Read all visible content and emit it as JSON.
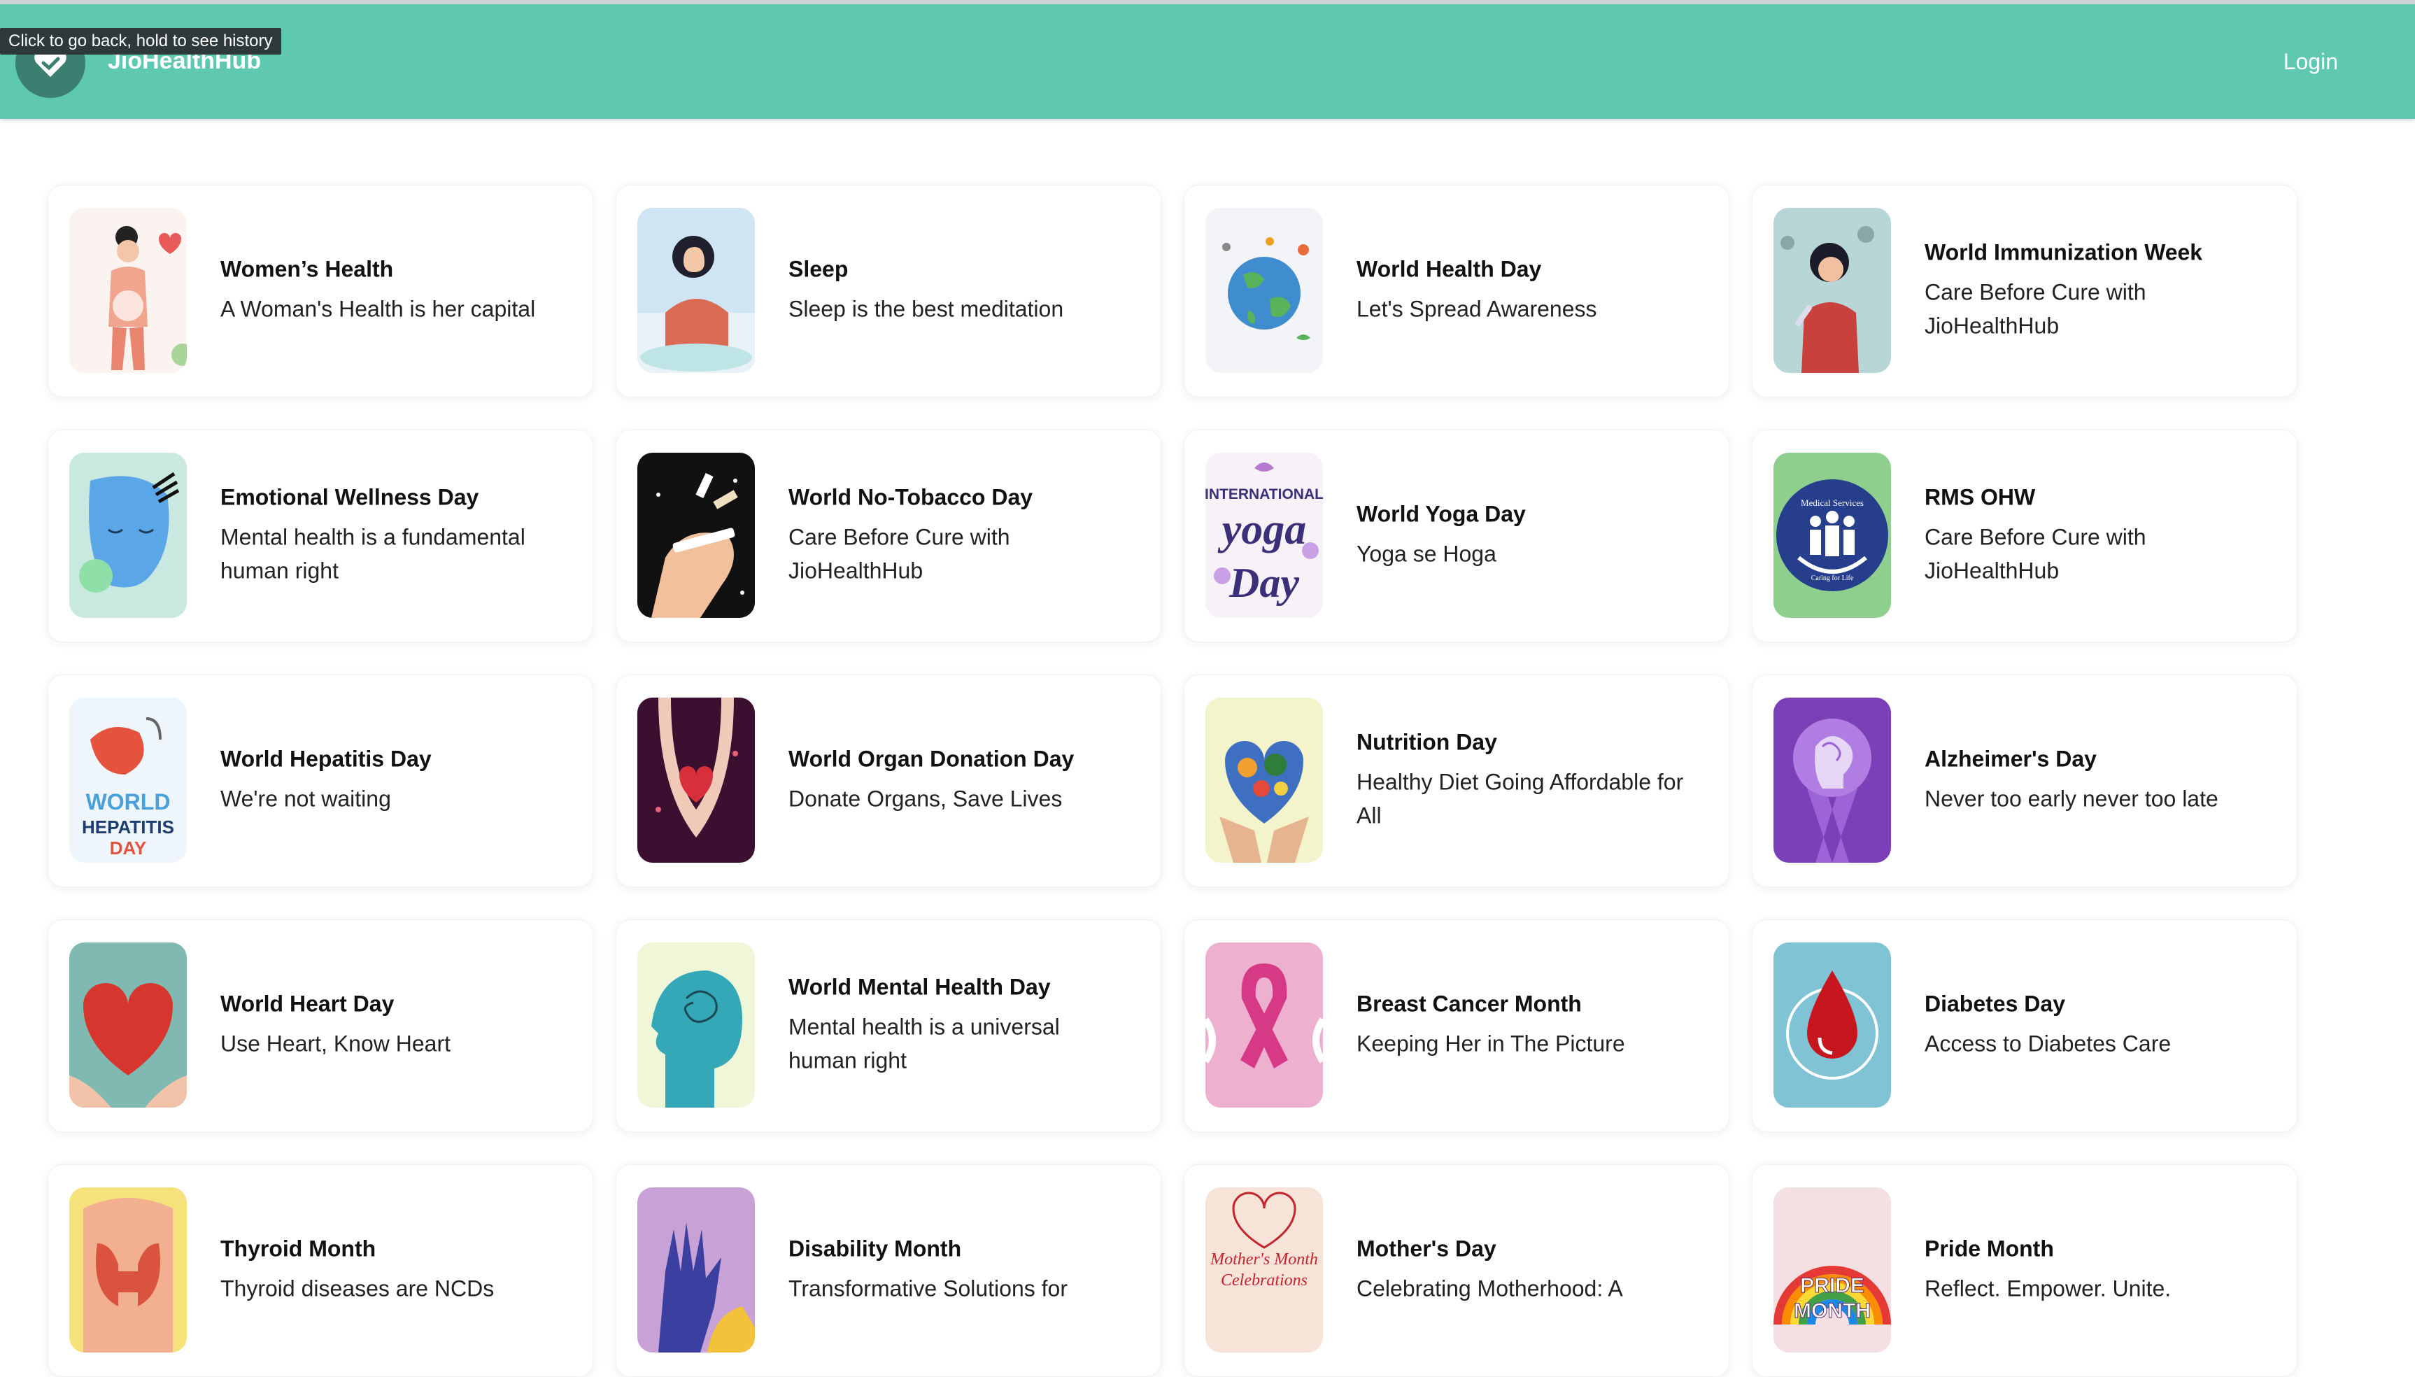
{
  "tooltip": "Click to go back, hold to see history",
  "header": {
    "brand": "JioHealthHub",
    "login": "Login",
    "accent": "#5ec8b1"
  },
  "cards": [
    {
      "title": "Women’s Health",
      "subtitle": "A Woman's Health is her capital",
      "image": "womens-health"
    },
    {
      "title": "Sleep",
      "subtitle": "Sleep is the best meditation",
      "image": "sleep"
    },
    {
      "title": "World Health Day",
      "subtitle": "Let's Spread Awareness",
      "image": "globe"
    },
    {
      "title": "World Immunization Week",
      "subtitle": "Care Before Cure with JioHealthHub",
      "image": "immunization"
    },
    {
      "title": "Emotional Wellness Day",
      "subtitle": "Mental health is a fundamental human right",
      "image": "emotional-face"
    },
    {
      "title": "World No-Tobacco Day",
      "subtitle": "Care Before Cure with JioHealthHub",
      "image": "no-tobacco"
    },
    {
      "title": "World Yoga Day",
      "subtitle": "Yoga se Hoga",
      "image": "yoga",
      "image_text": "INTERNATIONAL yoga Day"
    },
    {
      "title": "RMS OHW",
      "subtitle": "Care Before Cure with JioHealthHub",
      "image": "medical-services",
      "image_text": "Medical Services Caring for Life"
    },
    {
      "title": "World Hepatitis Day",
      "subtitle": "We're not waiting",
      "image": "hepatitis",
      "image_text": "WORLD HEPATITIS DAY"
    },
    {
      "title": "World Organ Donation Day",
      "subtitle": "Donate Organs, Save Lives",
      "image": "organ-donation"
    },
    {
      "title": "Nutrition Day",
      "subtitle": "Healthy Diet Going Affordable for All",
      "image": "nutrition"
    },
    {
      "title": "Alzheimer's Day",
      "subtitle": "Never too early never too late",
      "image": "alzheimers-ribbon"
    },
    {
      "title": "World Heart Day",
      "subtitle": "Use Heart, Know Heart",
      "image": "heart"
    },
    {
      "title": "World Mental Health Day",
      "subtitle": "Mental health is a universal human right",
      "image": "mind-head"
    },
    {
      "title": "Breast Cancer Month",
      "subtitle": "Keeping Her in The Picture",
      "image": "pink-ribbon"
    },
    {
      "title": "Diabetes Day",
      "subtitle": "Access to Diabetes Care",
      "image": "blood-drop"
    },
    {
      "title": "Thyroid Month",
      "subtitle": "Thyroid diseases are NCDs",
      "image": "thyroid"
    },
    {
      "title": "Disability Month",
      "subtitle": "Transformative Solutions for",
      "image": "hands"
    },
    {
      "title": "Mother's Day",
      "subtitle": "Celebrating Motherhood: A",
      "image": "mothers-day",
      "image_text": "Mother's Month Celebrations"
    },
    {
      "title": "Pride Month",
      "subtitle": "Reflect. Empower. Unite.",
      "image": "pride",
      "image_text": "PRIDE MONTH"
    }
  ]
}
